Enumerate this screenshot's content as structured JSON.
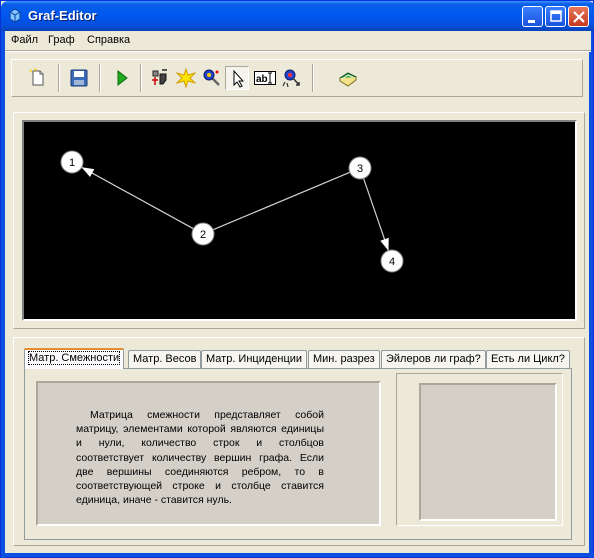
{
  "window": {
    "title": "Graf-Editor"
  },
  "menu": {
    "items": [
      "Файл",
      "Граф",
      "Справка"
    ]
  },
  "toolbar": {
    "tools": [
      "new-file-icon",
      "save-icon",
      "run-icon",
      "vertex-move-icon",
      "explosion-icon",
      "vertex-add-icon",
      "pointer-icon",
      "text-label-icon",
      "edge-connect-icon",
      "book-icon"
    ],
    "text_icon_label": "ab"
  },
  "graph": {
    "vertices": [
      {
        "label": "1"
      },
      {
        "label": "2"
      },
      {
        "label": "3"
      },
      {
        "label": "4"
      }
    ],
    "edges": [
      {
        "from": "2",
        "to": "1",
        "arrow": true
      },
      {
        "from": "2",
        "to": "3",
        "arrow": false
      },
      {
        "from": "3",
        "to": "4",
        "arrow": true
      }
    ],
    "colors": {
      "background": "#000000",
      "vertex": "#ffffff",
      "edge": "#d0d0d0"
    }
  },
  "tabs": {
    "items": [
      "Матр. Смежности",
      "Матр. Весов",
      "Матр. Инциденции",
      "Мин. разрез",
      "Эйлеров ли граф?",
      "Есть ли Цикл?"
    ],
    "selected": "Матр. Смежности"
  },
  "description": "Матрица смежности представляет собой матрицу, элементами которой являются единицы и нули, количество строк и столбцов соответствует количеству вершин графа. Если две вершины соединяются ребром, то в соответствующей строке и столбце ставится единица, иначе - ставится нуль."
}
